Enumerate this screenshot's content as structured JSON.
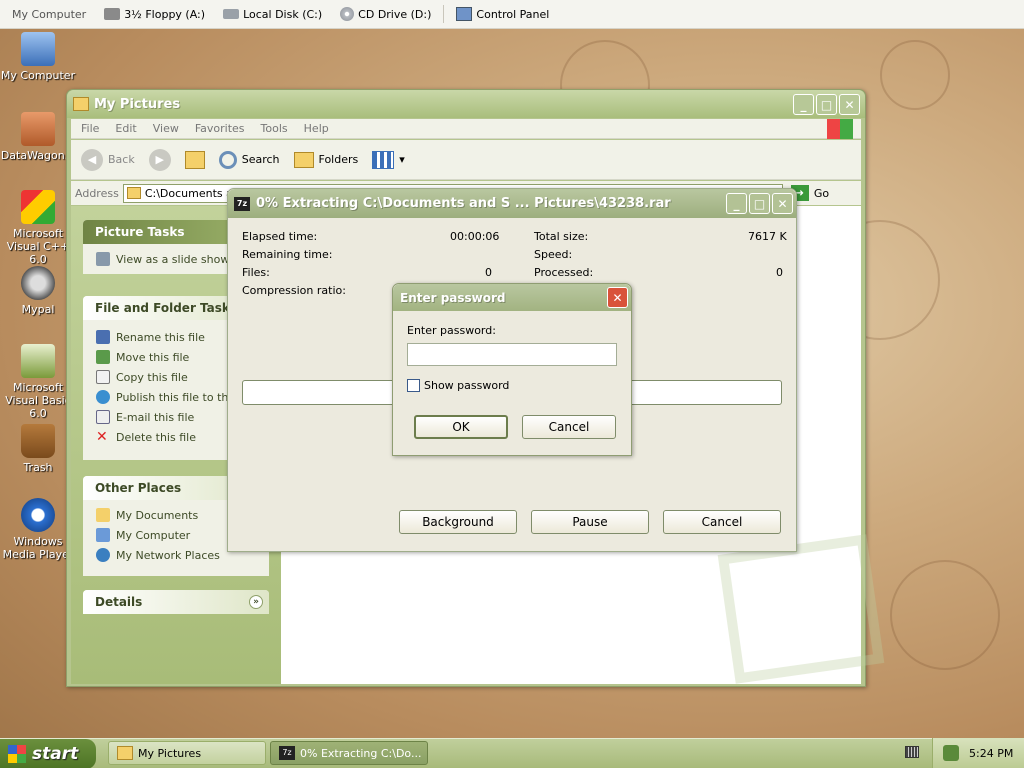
{
  "topbar": {
    "items": [
      "My Computer",
      "3½ Floppy (A:)",
      "Local Disk (C:)",
      "CD Drive (D:)",
      "Control Panel"
    ]
  },
  "desktop": {
    "icons": [
      {
        "label": "My Computer",
        "icon": "my-computer-icon"
      },
      {
        "label": "DataWagon...",
        "icon": "datawagon-icon"
      },
      {
        "label": "Microsoft Visual C++ 6.0",
        "icon": "visual-cpp-icon"
      },
      {
        "label": "Mypal",
        "icon": "mypal-icon"
      },
      {
        "label": "Microsoft Visual Basic 6.0",
        "icon": "visual-basic-icon"
      },
      {
        "label": "Trash",
        "icon": "trash-icon"
      },
      {
        "label": "Windows Media Player",
        "icon": "media-player-icon"
      }
    ]
  },
  "explorer": {
    "title": "My Pictures",
    "menu": [
      "File",
      "Edit",
      "View",
      "Favorites",
      "Tools",
      "Help"
    ],
    "toolbar": {
      "back": "Back",
      "search": "Search",
      "folders": "Folders"
    },
    "address_label": "Address",
    "address_value": "C:\\Documents and",
    "go": "Go",
    "picture_tasks": {
      "title": "Picture Tasks",
      "items": [
        "View as a slide show"
      ]
    },
    "file_tasks": {
      "title": "File and Folder Tasks",
      "items": [
        "Rename this file",
        "Move this file",
        "Copy this file",
        "Publish this file to the Web",
        "E-mail this file",
        "Delete this file"
      ]
    },
    "other_places": {
      "title": "Other Places",
      "items": [
        "My Documents",
        "My Computer",
        "My Network Places"
      ]
    },
    "details": {
      "title": "Details"
    }
  },
  "zip": {
    "title": "0% Extracting C:\\Documents and S ... Pictures\\43238.rar",
    "elapsed_label": "Elapsed time:",
    "elapsed_value": "00:00:06",
    "remaining_label": "Remaining time:",
    "files_label": "Files:",
    "files_value": "0",
    "ratio_label": "Compression ratio:",
    "total_label": "Total size:",
    "total_value": "7617 K",
    "speed_label": "Speed:",
    "processed_label": "Processed:",
    "processed_value": "0",
    "progress": 0,
    "buttons": {
      "background": "Background",
      "pause": "Pause",
      "cancel": "Cancel"
    }
  },
  "password": {
    "title": "Enter password",
    "label": "Enter password:",
    "value": "",
    "show_label": "Show password",
    "show_checked": false,
    "ok": "OK",
    "cancel": "Cancel"
  },
  "taskbar": {
    "start": "start",
    "tasks": [
      "My Pictures",
      "0% Extracting C:\\Do..."
    ],
    "clock": "5:24 PM"
  }
}
